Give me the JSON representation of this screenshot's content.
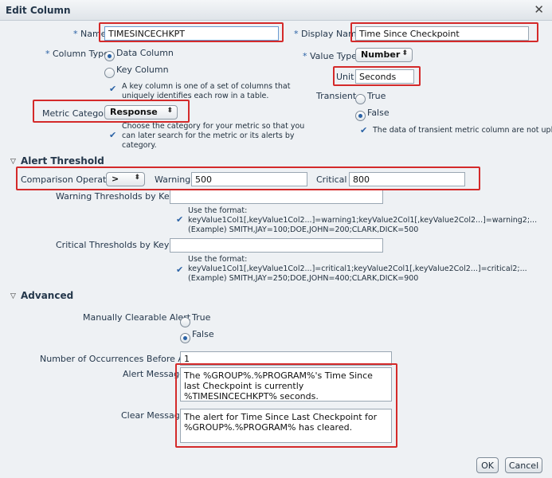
{
  "dialog": {
    "title": "Edit Column",
    "close_glyph": "✕"
  },
  "fields": {
    "name": {
      "label": "Name",
      "value": "TIMESINCECHKPT"
    },
    "display_name": {
      "label": "Display Name",
      "value": "Time Since Checkpoint"
    },
    "column_type": {
      "label": "Column Type",
      "options": [
        "Data Column",
        "Key Column"
      ],
      "selected": "Data Column",
      "hint_lines": [
        "A key column is one of a set of columns that",
        "uniquely identifies each row in a table."
      ]
    },
    "value_type": {
      "label": "Value Type",
      "value": "Number"
    },
    "unit": {
      "label": "Unit",
      "value": "Seconds"
    },
    "transient": {
      "label": "Transient",
      "options": [
        "True",
        "False"
      ],
      "selected": "False",
      "hint": "The data of transient metric column are not uploaded."
    },
    "metric_category": {
      "label": "Metric Category",
      "value": "Response",
      "hint_lines": [
        "Choose the category for your metric so that you",
        "can later search for the metric or its alerts by",
        "category."
      ]
    },
    "required_marker": "*"
  },
  "alert_threshold": {
    "section_title": "Alert Threshold",
    "comparison_operator": {
      "label": "Comparison Operator",
      "value": ">"
    },
    "warning": {
      "label": "Warning",
      "value": "500"
    },
    "critical": {
      "label": "Critical",
      "value": "800"
    },
    "warning_by_key": {
      "label": "Warning Thresholds by Key",
      "value": "",
      "hint_lines": [
        "Use the format:",
        "keyValue1Col1[,keyValue1Col2...]=warning1;keyValue2Col1[,keyValue2Col2...]=warning2;...",
        "(Example) SMITH,JAY=100;DOE,JOHN=200;CLARK,DICK=500"
      ]
    },
    "critical_by_key": {
      "label": "Critical Thresholds by Key",
      "value": "",
      "hint_lines": [
        "Use the format:",
        "keyValue1Col1[,keyValue1Col2...]=critical1;keyValue2Col1[,keyValue2Col2...]=critical2;...",
        "(Example) SMITH,JAY=250;DOE,JOHN=400;CLARK,DICK=900"
      ]
    }
  },
  "advanced": {
    "section_title": "Advanced",
    "manually_clearable": {
      "label": "Manually Clearable Alert",
      "options": [
        "True",
        "False"
      ],
      "selected": "False"
    },
    "occurrences": {
      "label": "Number of Occurrences Before Alert",
      "value": "1"
    },
    "alert_message": {
      "label": "Alert Message",
      "value": "The %GROUP%.%PROGRAM%'s Time Since last Checkpoint is currently %TIMESINCECHKPT% seconds."
    },
    "clear_message": {
      "label": "Clear Message",
      "value": "The alert for Time Since Last Checkpoint for %GROUP%.%PROGRAM% has cleared."
    }
  },
  "buttons": {
    "ok": "OK",
    "cancel": "Cancel"
  },
  "colors": {
    "highlight": "#d42a2a",
    "accent": "#2a62a5"
  }
}
